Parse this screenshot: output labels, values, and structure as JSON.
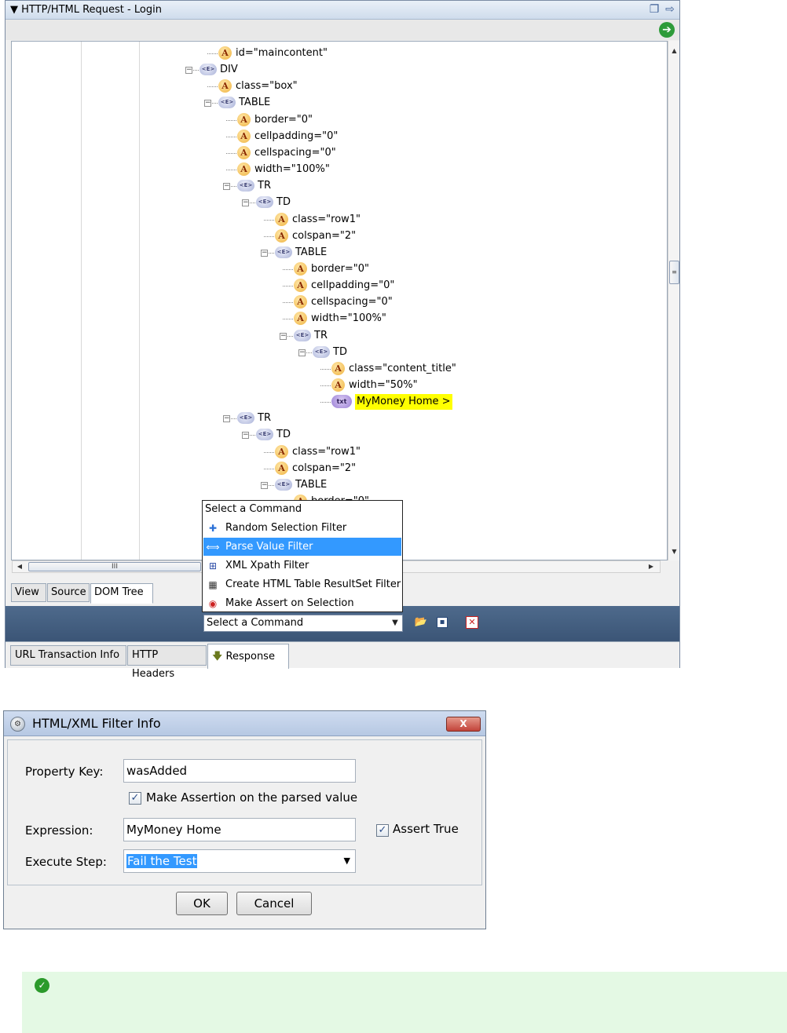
{
  "panel": {
    "title": "HTTP/HTML Request - Login",
    "icons": [
      "restore-icon",
      "arrow-right-icon",
      "go-icon"
    ]
  },
  "tree": {
    "nodes": [
      {
        "type": "attr",
        "label": "id=\"maincontent\""
      },
      {
        "type": "elem",
        "label": "DIV"
      },
      {
        "type": "attr",
        "label": "class=\"box\""
      },
      {
        "type": "elem",
        "label": "TABLE"
      },
      {
        "type": "attr",
        "label": "border=\"0\""
      },
      {
        "type": "attr",
        "label": "cellpadding=\"0\""
      },
      {
        "type": "attr",
        "label": "cellspacing=\"0\""
      },
      {
        "type": "attr",
        "label": "width=\"100%\""
      },
      {
        "type": "elem",
        "label": "TR"
      },
      {
        "type": "elem",
        "label": "TD"
      },
      {
        "type": "attr",
        "label": "class=\"row1\""
      },
      {
        "type": "attr",
        "label": "colspan=\"2\""
      },
      {
        "type": "elem",
        "label": "TABLE"
      },
      {
        "type": "attr",
        "label": "border=\"0\""
      },
      {
        "type": "attr",
        "label": "cellpadding=\"0\""
      },
      {
        "type": "attr",
        "label": "cellspacing=\"0\""
      },
      {
        "type": "attr",
        "label": "width=\"100%\""
      },
      {
        "type": "elem",
        "label": "TR"
      },
      {
        "type": "elem",
        "label": "TD"
      },
      {
        "type": "attr",
        "label": "class=\"content_title\""
      },
      {
        "type": "attr",
        "label": "width=\"50%\""
      },
      {
        "type": "text",
        "label": "MyMoney Home >"
      },
      {
        "type": "elem",
        "label": "TR"
      },
      {
        "type": "elem",
        "label": "TD"
      },
      {
        "type": "attr",
        "label": "class=\"row1\""
      },
      {
        "type": "attr",
        "label": "colspan=\"2\""
      },
      {
        "type": "elem",
        "label": "TABLE"
      },
      {
        "type": "attr",
        "label": "border=\"0\""
      }
    ],
    "elem_icon_text": "<E>",
    "attr_icon_text": "A",
    "text_icon_text": "txt",
    "hscroll_grip": "III"
  },
  "view_tabs": [
    "View",
    "Source",
    "DOM Tree"
  ],
  "view_tabs_active": "DOM Tree",
  "command_menu": {
    "header": "Select a Command",
    "items": [
      {
        "label": "Random Selection Filter",
        "icon": "random-filter-icon",
        "selected": false
      },
      {
        "label": "Parse Value Filter",
        "icon": "parse-filter-icon",
        "selected": true
      },
      {
        "label": "XML Xpath Filter",
        "icon": "xpath-filter-icon",
        "selected": false
      },
      {
        "label": "Create HTML Table ResultSet Filter",
        "icon": "table-filter-icon",
        "selected": false
      },
      {
        "label": "Make Assert on Selection",
        "icon": "assert-icon",
        "selected": false
      }
    ]
  },
  "command_bar": {
    "select_value": "Select a Command",
    "icons": [
      "open-folder-icon",
      "save-icon",
      "delete-icon"
    ]
  },
  "main_tabs": [
    "URL Transaction Info",
    "HTTP Headers",
    "Response"
  ],
  "main_tabs_active": "Response",
  "dialog": {
    "title": "HTML/XML Filter Info",
    "close_label": "X",
    "property_key_label": "Property Key:",
    "property_key_value": "wasAdded",
    "make_assertion_label": "Make Assertion on the parsed value",
    "make_assertion_checked": true,
    "expression_label": "Expression:",
    "expression_value": "MyMoney Home",
    "assert_true_label": "Assert True",
    "assert_true_checked": true,
    "execute_step_label": "Execute Step:",
    "execute_step_value": "Fail the Test",
    "ok_label": "OK",
    "cancel_label": "Cancel"
  },
  "colors": {
    "selection": "#3399ff",
    "highlight": "#ffff00",
    "command_bar": "#4e6a8c",
    "success_bg": "#e4f9e4",
    "success_icon": "#2b9a2b"
  }
}
